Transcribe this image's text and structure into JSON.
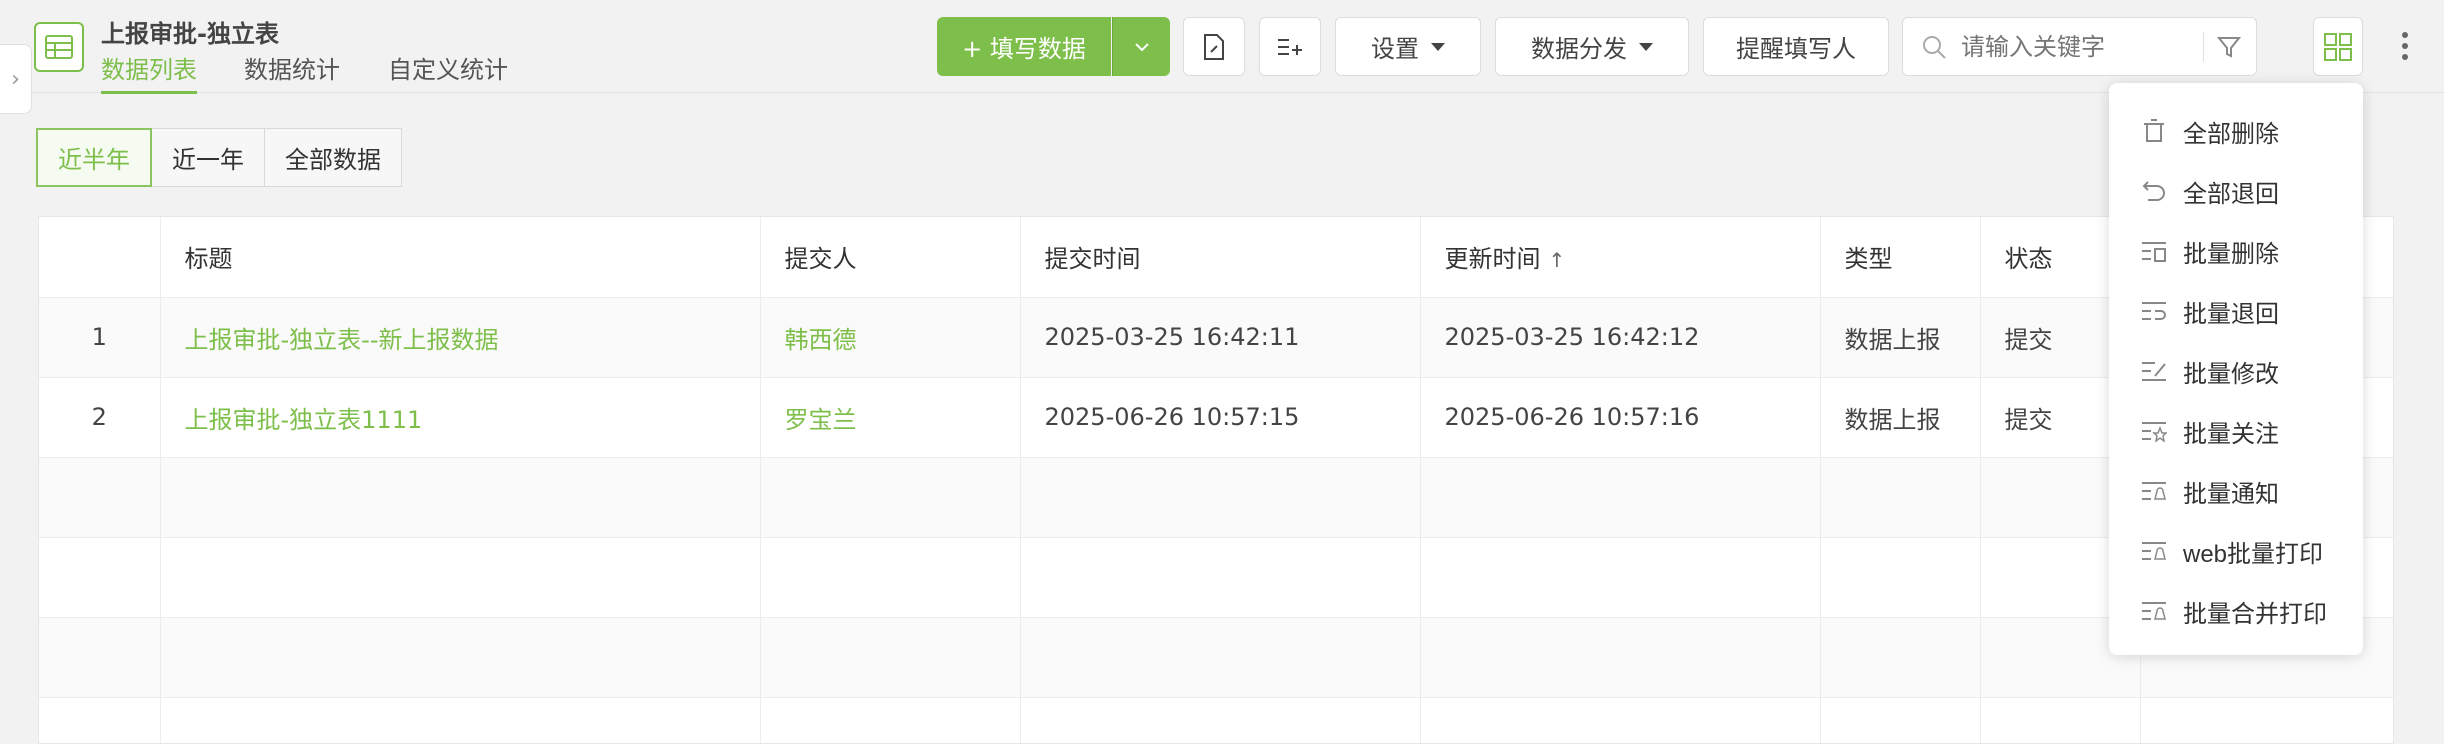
{
  "header": {
    "title": "上报审批-独立表",
    "tabs": [
      "数据列表",
      "数据统计",
      "自定义统计"
    ]
  },
  "toolbar": {
    "fill_data": "+ 填写数据",
    "settings": "设置",
    "distribute": "数据分发",
    "remind": "提醒填写人",
    "search_placeholder": "请输入关键字"
  },
  "filters": [
    "近半年",
    "近一年",
    "全部数据"
  ],
  "table": {
    "columns": [
      "",
      "标题",
      "提交人",
      "提交时间",
      "更新时间",
      "类型",
      "状态"
    ],
    "sort_arrow": "↑",
    "rows": [
      {
        "no": "1",
        "title": "上报审批-独立表--新上报数据",
        "submitter": "韩西德",
        "submit_time": "2025-03-25 16:42:11",
        "update_time": "2025-03-25 16:42:12",
        "type": "数据上报",
        "status": "提交"
      },
      {
        "no": "2",
        "title": "上报审批-独立表1111",
        "submitter": "罗宝兰",
        "submit_time": "2025-06-26 10:57:15",
        "update_time": "2025-06-26 10:57:16",
        "type": "数据上报",
        "status": "提交"
      }
    ]
  },
  "menu": {
    "items": [
      {
        "label": "全部删除",
        "icon": "trash-icon"
      },
      {
        "label": "全部退回",
        "icon": "undo-icon"
      },
      {
        "label": "批量删除",
        "icon": "batch-delete-icon"
      },
      {
        "label": "批量退回",
        "icon": "batch-return-icon"
      },
      {
        "label": "批量修改",
        "icon": "batch-edit-icon"
      },
      {
        "label": "批量关注",
        "icon": "batch-star-icon"
      },
      {
        "label": "批量通知",
        "icon": "batch-notify-icon"
      },
      {
        "label": "web批量打印",
        "icon": "batch-print-icon"
      },
      {
        "label": "批量合并打印",
        "icon": "batch-merge-print-icon"
      }
    ]
  },
  "colors": {
    "accent": "#7dbf4a"
  }
}
